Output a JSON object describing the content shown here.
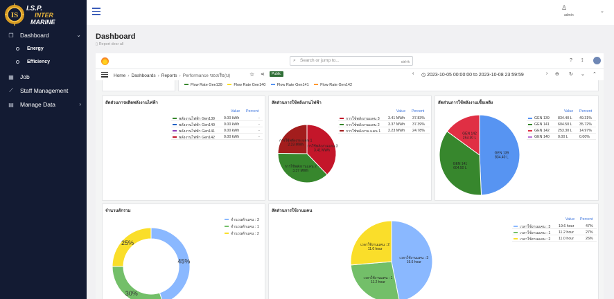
{
  "sidebar": {
    "logo_text_top": "I.S.P.",
    "logo_text_mid": "INTER",
    "logo_text_bot": "MARINE",
    "items": [
      {
        "label": "Dashboard",
        "icon": "dashboard-icon"
      },
      {
        "label": "Energy",
        "icon": "circle-icon"
      },
      {
        "label": "Efficiency",
        "icon": "circle-icon"
      },
      {
        "label": "Job",
        "icon": "grid-icon"
      },
      {
        "label": "Staff Management",
        "icon": "wrench-icon"
      },
      {
        "label": "Manage Data",
        "icon": "book-icon"
      }
    ]
  },
  "topbar": {
    "username": "admin"
  },
  "page": {
    "title": "Dashboard",
    "subtitle": "Report desr all"
  },
  "grafana": {
    "search_placeholder": "Search or jump to...",
    "search_shortcut": "ctrl+k",
    "breadcrumbs": [
      "Home",
      "Dashboards",
      "Reports",
      "Performance ของเรือ(ม)"
    ],
    "public_badge": "Public",
    "time_range": "2023-10-05 00:00:00 to 2023-10-08 23:59:59"
  },
  "flow_legend": [
    {
      "label": "Flow Rate Gen139",
      "color": "#37872d"
    },
    {
      "label": "Flow Rate Gen140",
      "color": "#fade2a"
    },
    {
      "label": "Flow Rate Gen141",
      "color": "#5794f2"
    },
    {
      "label": "Flow Rate Gen142",
      "color": "#ff9830"
    }
  ],
  "panel1": {
    "title": "สัดส่วนการผลิตพลังงานไฟฟ้า",
    "value_header": "Value",
    "percent_header": "Percent",
    "rows": [
      {
        "name": "พลังงานไฟฟ้า Gen139",
        "value": "0.00 kWh",
        "percent": "-",
        "color": "#37872d"
      },
      {
        "name": "พลังงานไฟฟ้า Gen140",
        "value": "0.00 kWh",
        "percent": "-",
        "color": "#1f60c4"
      },
      {
        "name": "พลังงานไฟฟ้า Gen141",
        "value": "0.00 kWh",
        "percent": "-",
        "color": "#8f3bb8"
      },
      {
        "name": "พลังงานไฟฟ้า Gen142",
        "value": "0.00 kWh",
        "percent": "-",
        "color": "#c4162a"
      }
    ]
  },
  "panel2": {
    "title": "สัดส่วนการใช้พลังงานไฟฟ้า",
    "value_header": "Value",
    "percent_header": "Percent",
    "rows": [
      {
        "name": "การใช้พลังงานแคน 3",
        "value": "3.41 MWh",
        "percent": "37.83%",
        "color": "#c4162a"
      },
      {
        "name": "การใช้พลังงานแคน 2",
        "value": "3.37 MWh",
        "percent": "37.39%",
        "color": "#37872d"
      },
      {
        "name": "การใช้พลังงาน แคน 1",
        "value": "2.23 MWh",
        "percent": "24.78%",
        "color": "#a31d1d"
      }
    ],
    "slice_labels": [
      {
        "line1": "การใช้พลังงานแคน 3",
        "line2": "3.41 MWh"
      },
      {
        "line1": "การใช้พลังงานแคน 2",
        "line2": "3.37 MWh"
      },
      {
        "line1": "การใช้พลังงาน แคน 1",
        "line2": "2.23 MWh"
      }
    ]
  },
  "panel3": {
    "title": "สัดส่วนการใช้พลังงานเชื้อเพลิง",
    "value_header": "Value",
    "percent_header": "Percent",
    "rows": [
      {
        "name": "GEN 139",
        "value": "834.40 L",
        "percent": "49.31%",
        "color": "#5794f2"
      },
      {
        "name": "GEN 141",
        "value": "604.50 L",
        "percent": "35.72%",
        "color": "#37872d"
      },
      {
        "name": "GEN 142",
        "value": "253.30 L",
        "percent": "14.97%",
        "color": "#e02f44"
      },
      {
        "name": "GEN 140",
        "value": "0.00 L",
        "percent": "0.00%",
        "color": "#b877d9"
      }
    ],
    "slice_labels": [
      {
        "line1": "GEN 139",
        "line2": "834.40 L"
      },
      {
        "line1": "GEN 141",
        "line2": "604.50 L"
      },
      {
        "line1": "GEN 142",
        "line2": "253.30 L"
      }
    ]
  },
  "panel4": {
    "title": "จำนวนตักรวม",
    "legend": [
      {
        "name": "จำนวนตักแคน : 3",
        "color": "#8ab8ff"
      },
      {
        "name": "จำนวนตักแคน : 1",
        "color": "#73bf69"
      },
      {
        "name": "จำนวนตักแคน : 2",
        "color": "#fade2a"
      }
    ],
    "slice_labels": [
      "45%",
      "30%",
      "25%"
    ]
  },
  "panel5": {
    "title": "สัดส่วนการใช้งานแคน",
    "value_header": "Value",
    "percent_header": "Percent",
    "rows": [
      {
        "name": "เวลาใช้งานแคน : 3",
        "value": "19.6 hour",
        "percent": "47%",
        "color": "#8ab8ff"
      },
      {
        "name": "เวลาใช้งานแคน : 1",
        "value": "11.2 hour",
        "percent": "27%",
        "color": "#73bf69"
      },
      {
        "name": "เวลาใช้งานแคน : 2",
        "value": "11.0 hour",
        "percent": "26%",
        "color": "#fade2a"
      }
    ],
    "slice_labels": [
      {
        "line1": "เวลาใช้งานแคน : 3",
        "line2": "19.6 hour"
      },
      {
        "line1": "เวลาใช้งานแคน : 1",
        "line2": "11.2 hour"
      },
      {
        "line1": "เวลาใช้งานแคน : 2",
        "line2": "11.0 hour"
      }
    ]
  },
  "chart_data": [
    {
      "type": "table",
      "title": "สัดส่วนการผลิตพลังงานไฟฟ้า",
      "categories": [
        "พลังงานไฟฟ้า Gen139",
        "พลังงานไฟฟ้า Gen140",
        "พลังงานไฟฟ้า Gen141",
        "พลังงานไฟฟ้า Gen142"
      ],
      "values": [
        0,
        0,
        0,
        0
      ],
      "unit": "kWh"
    },
    {
      "type": "pie",
      "title": "สัดส่วนการใช้พลังงานไฟฟ้า",
      "categories": [
        "การใช้พลังงานแคน 3",
        "การใช้พลังงานแคน 2",
        "การใช้พลังงาน แคน 1"
      ],
      "values": [
        3.41,
        3.37,
        2.23
      ],
      "percents": [
        37.83,
        37.39,
        24.78
      ],
      "colors": [
        "#c4162a",
        "#37872d",
        "#a31d1d"
      ],
      "unit": "MWh"
    },
    {
      "type": "pie",
      "title": "สัดส่วนการใช้พลังงานเชื้อเพลิง",
      "categories": [
        "GEN 139",
        "GEN 141",
        "GEN 142",
        "GEN 140"
      ],
      "values": [
        834.4,
        604.5,
        253.3,
        0
      ],
      "percents": [
        49.31,
        35.72,
        14.97,
        0
      ],
      "colors": [
        "#5794f2",
        "#37872d",
        "#e02f44",
        "#b877d9"
      ],
      "unit": "L"
    },
    {
      "type": "pie",
      "donut": true,
      "title": "จำนวนตักรวม",
      "categories": [
        "จำนวนตักแคน : 3",
        "จำนวนตักแคน : 1",
        "จำนวนตักแคน : 2"
      ],
      "values": [
        45,
        30,
        25
      ],
      "colors": [
        "#8ab8ff",
        "#73bf69",
        "#fade2a"
      ],
      "unit": "%"
    },
    {
      "type": "pie",
      "title": "สัดส่วนการใช้งานแคน",
      "categories": [
        "เวลาใช้งานแคน : 3",
        "เวลาใช้งานแคน : 1",
        "เวลาใช้งานแคน : 2"
      ],
      "values": [
        19.6,
        11.2,
        11.0
      ],
      "percents": [
        47,
        27,
        26
      ],
      "colors": [
        "#8ab8ff",
        "#73bf69",
        "#fade2a"
      ],
      "unit": "hour"
    }
  ]
}
